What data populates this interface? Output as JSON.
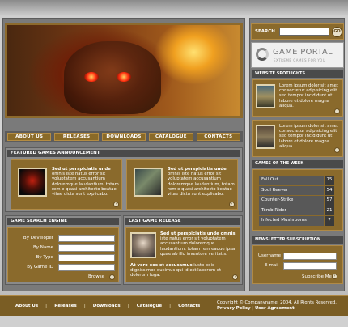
{
  "nav": [
    "ABOUT US",
    "RELEASES",
    "DOWNLOADS",
    "CATALOGUE",
    "CONTACTS"
  ],
  "search": {
    "label": "SEARCH",
    "go": "GO"
  },
  "logo": {
    "title": "GAME PORTAL",
    "subtitle": "EXTREME GAMES FOR YOU"
  },
  "spotlights": {
    "heading": "WEBSITE SPOTLIGHTS",
    "items": [
      "Lorem ipsum dolor sit amet consectetur adipisicing elit sed tempor incididunt ut labore et dolore magna aliqua.",
      "Lorem ipsum dolor sit amet consectetur adipisicing elit sed tempor incididunt ut labore et dolore magna aliqua."
    ]
  },
  "featured": {
    "heading": "FEATURED GAMES ANNOUNCEMENT",
    "items": [
      {
        "title": "Sed ut perspiciatis unde",
        "text": "omnis iste natus error sit voluptatem accusantium doloremque laudantium, totam rem e quasi architecto beatae vitae dicta sunt explicabo."
      },
      {
        "title": "Sed ut perspiciatis unde",
        "text": "omnis iste natus error sit voluptatem accusantium doloremque laudantium, totam rem e quasi architecto beatae vitae dicta sunt explicabo."
      }
    ]
  },
  "game_search": {
    "heading": "GAME SEARCH ENGINE",
    "fields": [
      "By Developer",
      "By Name",
      "By Type",
      "By Game ID"
    ],
    "browse": "Browse"
  },
  "last_release": {
    "heading": "LAST GAME RELEASE",
    "title": "Sed ut perspiciatis unde omnis",
    "text": "iste natus error sit voluptatem accusantium doloremque laudantium, totam rem eaque ipsa quae ab illo inventore veritatis.",
    "text2_bold": "At vero eos et accusamus",
    "text2": "iusto odio dignissimos ducimus qui id est laborum et dolorum fuga."
  },
  "top5": {
    "heading": "GAMES OF THE WEEK",
    "rows": [
      {
        "name": "Fall Out",
        "rank": "75"
      },
      {
        "name": "Soul Reever",
        "rank": "54"
      },
      {
        "name": "Counter-Strike",
        "rank": "57"
      },
      {
        "name": "Tomb Rider",
        "rank": "21"
      },
      {
        "name": "Infected Mushrooms",
        "rank": "7"
      }
    ]
  },
  "newsletter": {
    "heading": "NEWSLETTER SUBSCRIPTION",
    "username": "Username",
    "email": "E-mail",
    "subscribe": "Subscribe Me"
  },
  "footer": {
    "links": [
      "About Us",
      "Releases",
      "Downloads",
      "Catalogue",
      "Contacts"
    ],
    "copyright": "Copyright © Companyname, 2004. All Rights Reserved.",
    "privacy": "Privacy Policy",
    "agreement": "User Agreement"
  }
}
